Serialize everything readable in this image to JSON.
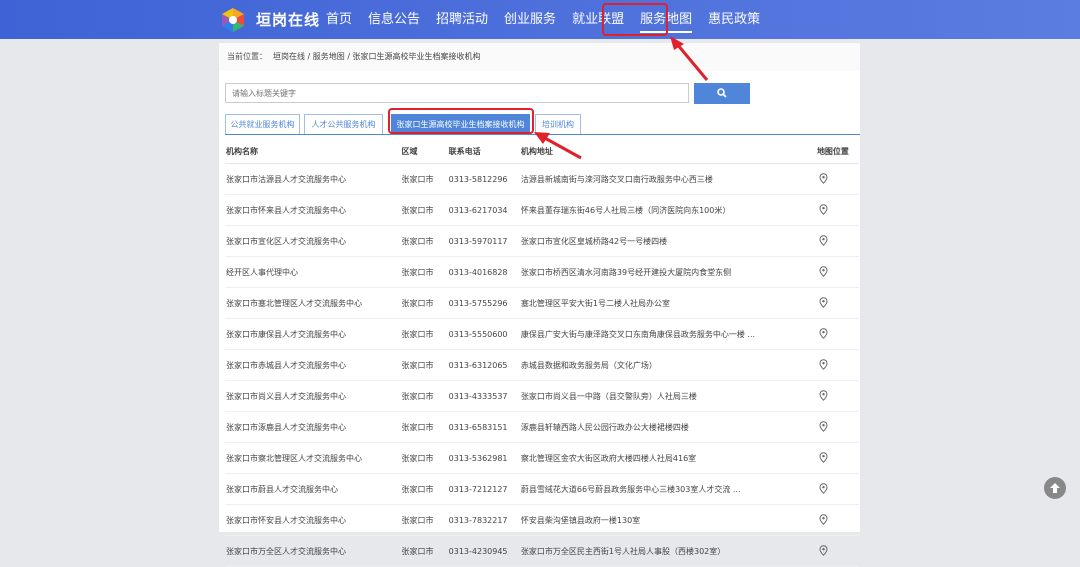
{
  "header": {
    "brand": "垣岗在线",
    "nav": [
      "首页",
      "信息公告",
      "招聘活动",
      "创业服务",
      "就业联盟",
      "服务地图",
      "惠民政策"
    ],
    "active_nav": "服务地图"
  },
  "breadcrumb": {
    "label": "当前位置：",
    "path": "垣岗在线 / 服务地图 / 张家口生源高校毕业生档案接收机构"
  },
  "search": {
    "placeholder": "请输入标题关键字"
  },
  "tabs": [
    "公共就业服务机构",
    "人才公共服务机构",
    "张家口生源高校毕业生档案接收机构",
    "培训机构"
  ],
  "active_tab": "张家口生源高校毕业生档案接收机构",
  "table": {
    "headers": [
      "机构名称",
      "区域",
      "联系电话",
      "机构地址",
      "地图位置"
    ],
    "rows": [
      [
        "张家口市沽源县人才交流服务中心",
        "张家口市",
        "0313-5812296",
        "沽源县新城南街与滦河路交叉口南行政服务中心西三楼"
      ],
      [
        "张家口市怀来县人才交流服务中心",
        "张家口市",
        "0313-6217034",
        "怀来县董存瑞东街46号人社局三楼（同济医院向东100米）"
      ],
      [
        "张家口市宣化区人才交流服务中心",
        "张家口市",
        "0313-5970117",
        "张家口市宣化区皇城桥路42号一号楼四楼"
      ],
      [
        "经开区人事代理中心",
        "张家口市",
        "0313-4016828",
        "张家口市桥西区清水河南路39号经开建投大厦院内食堂东侧"
      ],
      [
        "张家口市塞北管理区人才交流服务中心",
        "张家口市",
        "0313-5755296",
        "塞北管理区平安大街1号二楼人社局办公室"
      ],
      [
        "张家口市康保县人才交流服务中心",
        "张家口市",
        "0313-5550600",
        "康保县广安大街与康泽路交叉口东南角康保县政务服务中心一楼 ..."
      ],
      [
        "张家口市赤城县人才交流服务中心",
        "张家口市",
        "0313-6312065",
        "赤城县数据和政务服务局（文化广场）"
      ],
      [
        "张家口市尚义县人才交流服务中心",
        "张家口市",
        "0313-4333537",
        "张家口市尚义县一中路（县交警队旁）人社局三楼"
      ],
      [
        "张家口市涿鹿县人才交流服务中心",
        "张家口市",
        "0313-6583151",
        "涿鹿县轩辕西路人民公园行政办公大楼裙楼四楼"
      ],
      [
        "张家口市察北管理区人才交流服务中心",
        "张家口市",
        "0313-5362981",
        "察北管理区金农大街区政府大楼四楼人社局416室"
      ],
      [
        "张家口市蔚县人才交流服务中心",
        "张家口市",
        "0313-7212127",
        "蔚县雪绒花大道66号蔚县政务服务中心三楼303室人才交流 ..."
      ],
      [
        "张家口市怀安县人才交流服务中心",
        "张家口市",
        "0313-7832217",
        "怀安县柴沟堡镇县政府一楼130室"
      ],
      [
        "张家口市万全区人才交流服务中心",
        "张家口市",
        "0313-4230945",
        "张家口市万全区民主西街1号人社局人事股（西楼302室）"
      ]
    ]
  },
  "colors": {
    "header": "#4a6ddb",
    "accent": "#4f86d9",
    "highlight": "#e0202a"
  },
  "icons": [
    "logo-icon",
    "search-icon",
    "map-pin-icon",
    "arrow-up-icon"
  ]
}
